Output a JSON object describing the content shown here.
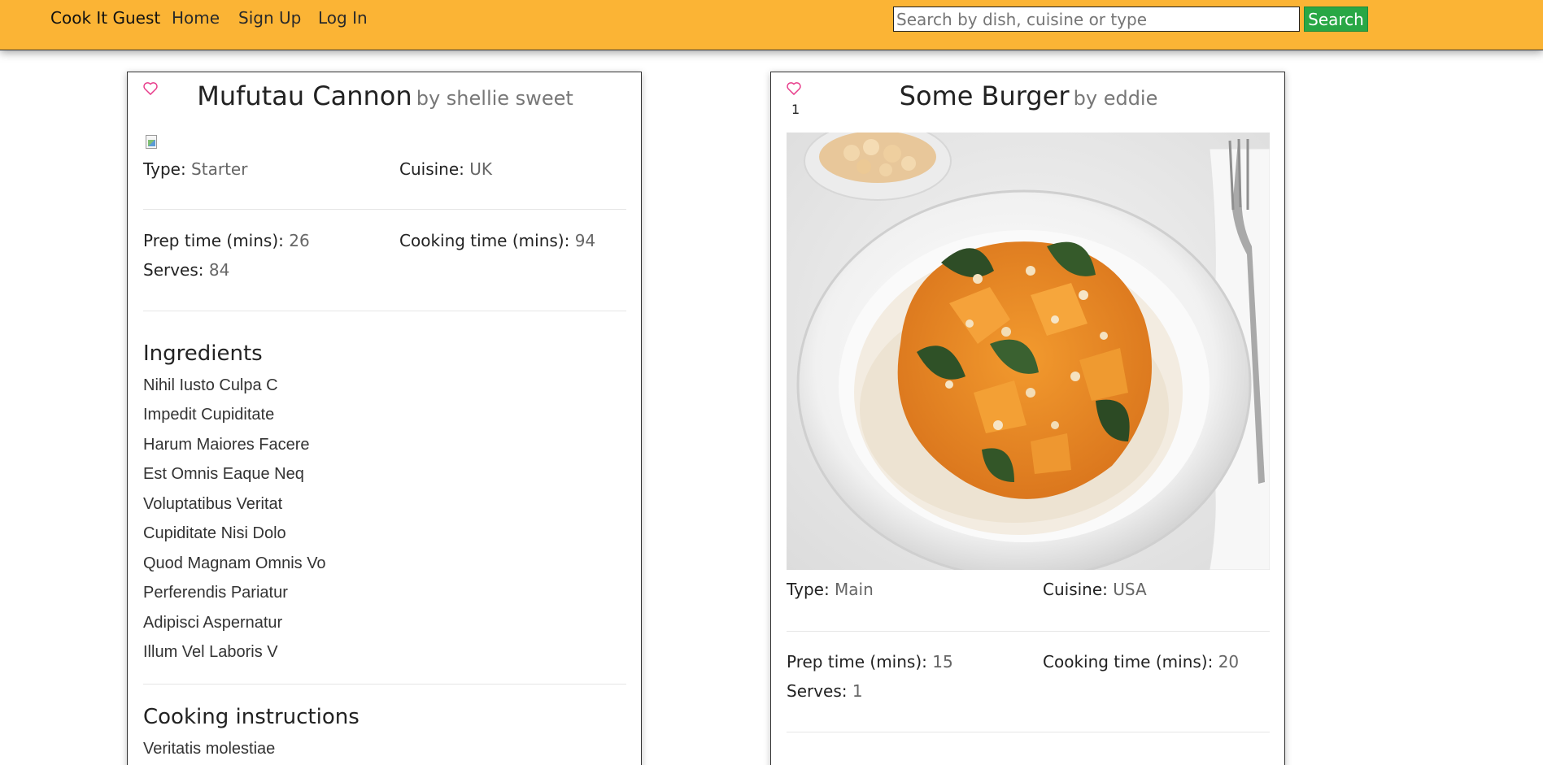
{
  "nav": {
    "brand": "Cook It Guest",
    "links": [
      "Home",
      "Sign Up",
      "Log In"
    ],
    "search_placeholder": "Search by dish, cuisine or type",
    "search_value": "",
    "search_button": "Search"
  },
  "colors": {
    "navbar": "#fbb435",
    "search_button": "#28a745",
    "heart": "#e83e8c"
  },
  "recipes": [
    {
      "name": "Mufutau Cannon",
      "author": "by shellie sweet",
      "likes": "",
      "image": "broken-image-icon",
      "type_label": "Type:",
      "type": "Starter",
      "cuisine_label": "Cuisine:",
      "cuisine": "UK",
      "prep_label": "Prep time (mins):",
      "prep": "26",
      "cook_label": "Cooking time (mins):",
      "cook": "94",
      "serves_label": "Serves:",
      "serves": "84",
      "ingredients_title": "Ingredients",
      "ingredients": [
        "Nihil Iusto Culpa C",
        "Impedit Cupiditate",
        "Harum Maiores Facere",
        "Est Omnis Eaque Neq",
        "Voluptatibus Veritat",
        "Cupiditate Nisi Dolo",
        "Quod Magnam Omnis Vo",
        "Perferendis Pariatur",
        "Adipisci Aspernatur",
        "Illum Vel Laboris V"
      ],
      "instructions_title": "Cooking instructions",
      "instructions": [
        "Veritatis molestiae"
      ]
    },
    {
      "name": "Some Burger",
      "author": "by eddie",
      "likes": "1",
      "image": "curry-dish-photo",
      "type_label": "Type:",
      "type": "Main",
      "cuisine_label": "Cuisine:",
      "cuisine": "USA",
      "prep_label": "Prep time (mins):",
      "prep": "15",
      "cook_label": "Cooking time (mins):",
      "cook": "20",
      "serves_label": "Serves:",
      "serves": "1"
    }
  ]
}
